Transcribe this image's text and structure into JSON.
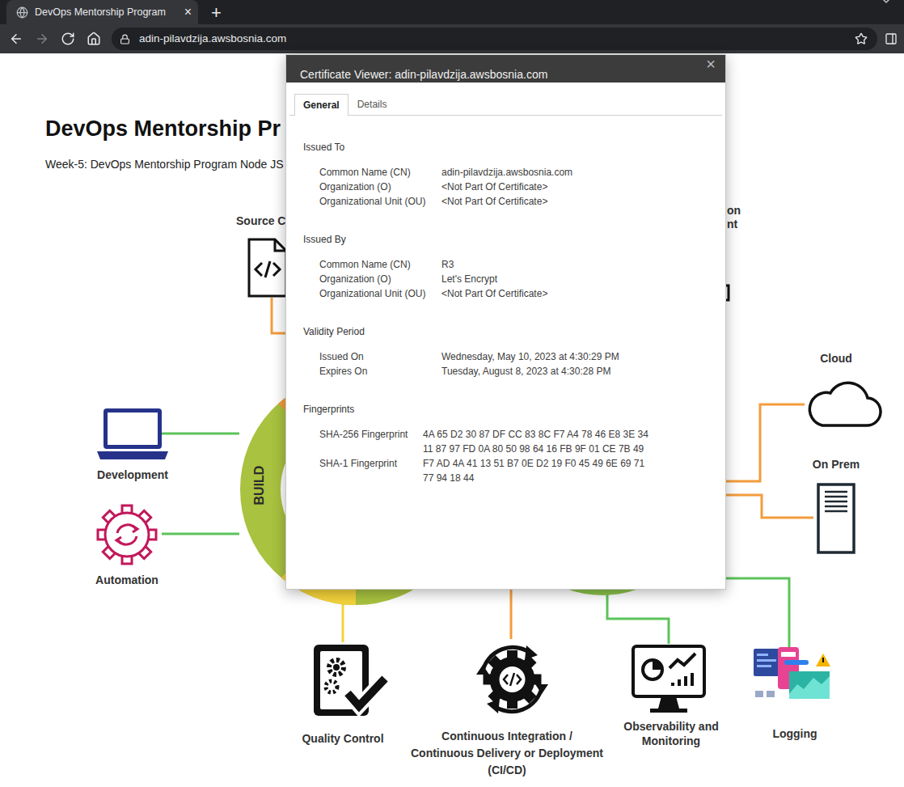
{
  "browser": {
    "tabs": [
      {
        "title": "DevOps Mentorship Program",
        "close": "×",
        "selected": true
      }
    ],
    "new_tab": "+",
    "nav_buttons": [
      {
        "kind": "back",
        "disabled": false
      },
      {
        "kind": "forward",
        "disabled": true
      },
      {
        "kind": "reload",
        "disabled": false
      },
      {
        "kind": "home",
        "disabled": false
      }
    ],
    "url": "adin-pilavdzija.awsbosnia.com"
  },
  "page": {
    "heading": "DevOps Mentorship Pr",
    "subtitle": "Week-5: DevOps Mentorship Program Node JS",
    "diagram": {
      "center_label": "BUILD",
      "nodes": [
        {
          "kind": "source-code",
          "lines": [
            "Source C"
          ]
        },
        {
          "kind": "partial",
          "lines": [
            "on",
            "nt"
          ]
        },
        {
          "kind": "development",
          "lines": [
            "Development"
          ]
        },
        {
          "kind": "automation",
          "lines": [
            "Automation"
          ]
        },
        {
          "kind": "cloud",
          "lines": [
            "Cloud"
          ]
        },
        {
          "kind": "on-prem",
          "lines": [
            "On Prem"
          ]
        },
        {
          "kind": "quality",
          "lines": [
            "Quality Control"
          ]
        },
        {
          "kind": "cicd",
          "lines": [
            "Continuous Integration /",
            "Continuous Delivery or Deployment",
            "(CI/CD)"
          ]
        },
        {
          "kind": "monitoring",
          "lines": [
            "Observability and",
            "Monitoring"
          ]
        },
        {
          "kind": "logging",
          "lines": [
            "Logging"
          ]
        }
      ]
    }
  },
  "dialog": {
    "title": "Certificate Viewer: adin-pilavdzija.awsbosnia.com",
    "close": "×",
    "tabs": [
      {
        "label": "General",
        "selected": true
      },
      {
        "label": "Details",
        "selected": false
      }
    ],
    "sections": [
      {
        "kind": "fields",
        "heading": "Issued To",
        "rows": [
          {
            "label": "Common Name (CN)",
            "value": "adin-pilavdzija.awsbosnia.com"
          },
          {
            "label": "Organization (O)",
            "value": "<Not Part Of Certificate>"
          },
          {
            "label": "Organizational Unit (OU)",
            "value": "<Not Part Of Certificate>"
          }
        ]
      },
      {
        "kind": "fields",
        "heading": "Issued By",
        "rows": [
          {
            "label": "Common Name (CN)",
            "value": "R3"
          },
          {
            "label": "Organization (O)",
            "value": "Let's Encrypt"
          },
          {
            "label": "Organizational Unit (OU)",
            "value": "<Not Part Of Certificate>"
          }
        ]
      },
      {
        "kind": "fields",
        "heading": "Validity Period",
        "rows": [
          {
            "label": "Issued On",
            "value": "Wednesday, May 10, 2023 at 4:30:29 PM"
          },
          {
            "label": "Expires On",
            "value": "Tuesday, August 8, 2023 at 4:30:28 PM"
          }
        ]
      },
      {
        "kind": "fingerprints",
        "heading": "Fingerprints",
        "rows": [
          {
            "label": "SHA-256 Fingerprint",
            "lines": [
              "4A 65 D2 30 87 DF CC 83 8C F7 A4 78 46 E8 3E 34",
              "11 87 97 FD 0A 80 50 98 64 16 FB 9F 01 CE 7B 49"
            ]
          },
          {
            "label": "SHA-1 Fingerprint",
            "lines": [
              "F7 AD 4A 41 13 51 B7 0E D2 19 F0 45 49 6E 69 71",
              "77 94 18 44"
            ]
          }
        ]
      }
    ]
  }
}
